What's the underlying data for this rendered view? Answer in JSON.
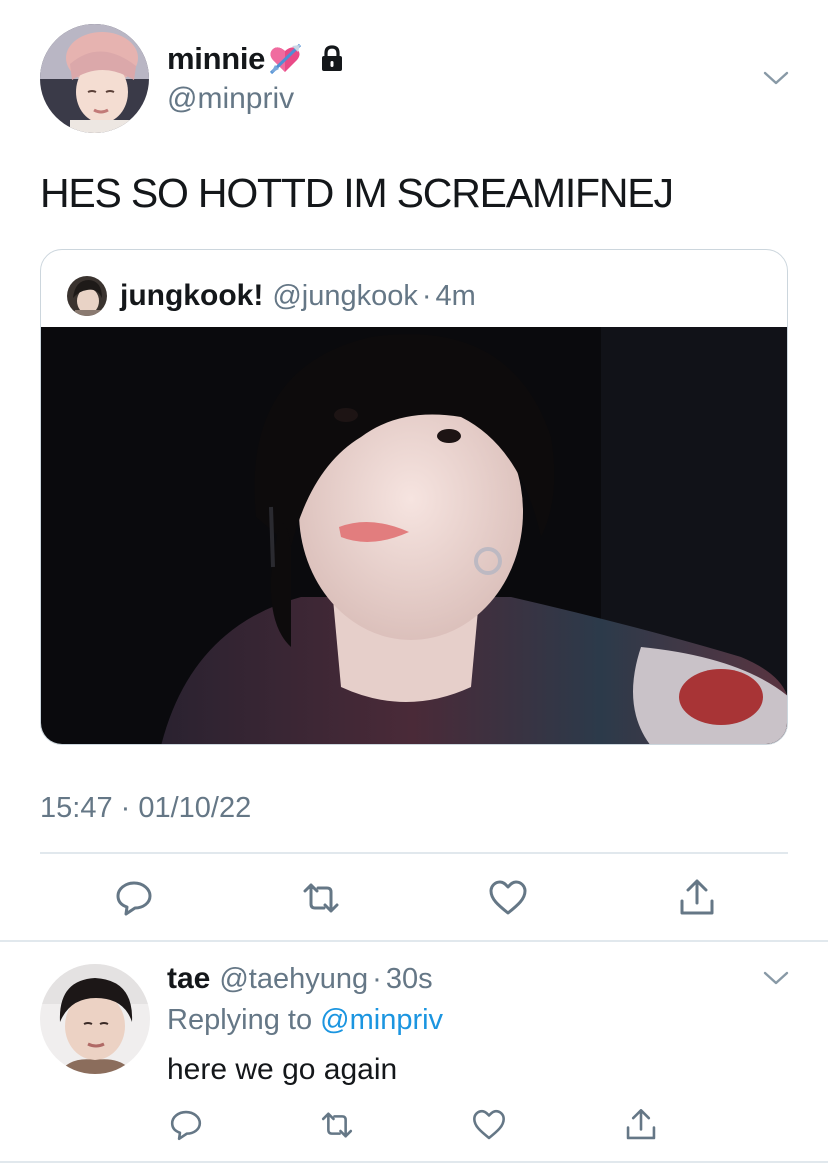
{
  "colors": {
    "text": "#14171a",
    "secondary": "#657786",
    "link": "#1b95e0",
    "border": "#e1e8ed",
    "card_border": "#ccd6dd"
  },
  "main_tweet": {
    "display_name": "minnie",
    "name_emoji": "heart-with-arrow-emoji",
    "protected_icon": "lock-icon",
    "handle": "@minpriv",
    "menu_icon": "chevron-down-icon",
    "text": "HES SO HOTTD IM SCREAMIFNEJ",
    "quoted": {
      "display_name": "jungkook!",
      "handle": "@jungkook",
      "separator": "·",
      "time": "4m"
    },
    "timestamp": "15:47 · 01/10/22",
    "actions": [
      "reply-icon",
      "retweet-icon",
      "like-icon",
      "share-icon"
    ]
  },
  "reply": {
    "display_name": "tae",
    "handle": "@taehyung",
    "separator": "·",
    "time": "30s",
    "replying_prefix": "Replying to",
    "replying_to": "@minpriv",
    "text": "here we go again",
    "menu_icon": "chevron-down-icon",
    "actions": [
      "reply-icon",
      "retweet-icon",
      "like-icon",
      "share-icon"
    ]
  }
}
